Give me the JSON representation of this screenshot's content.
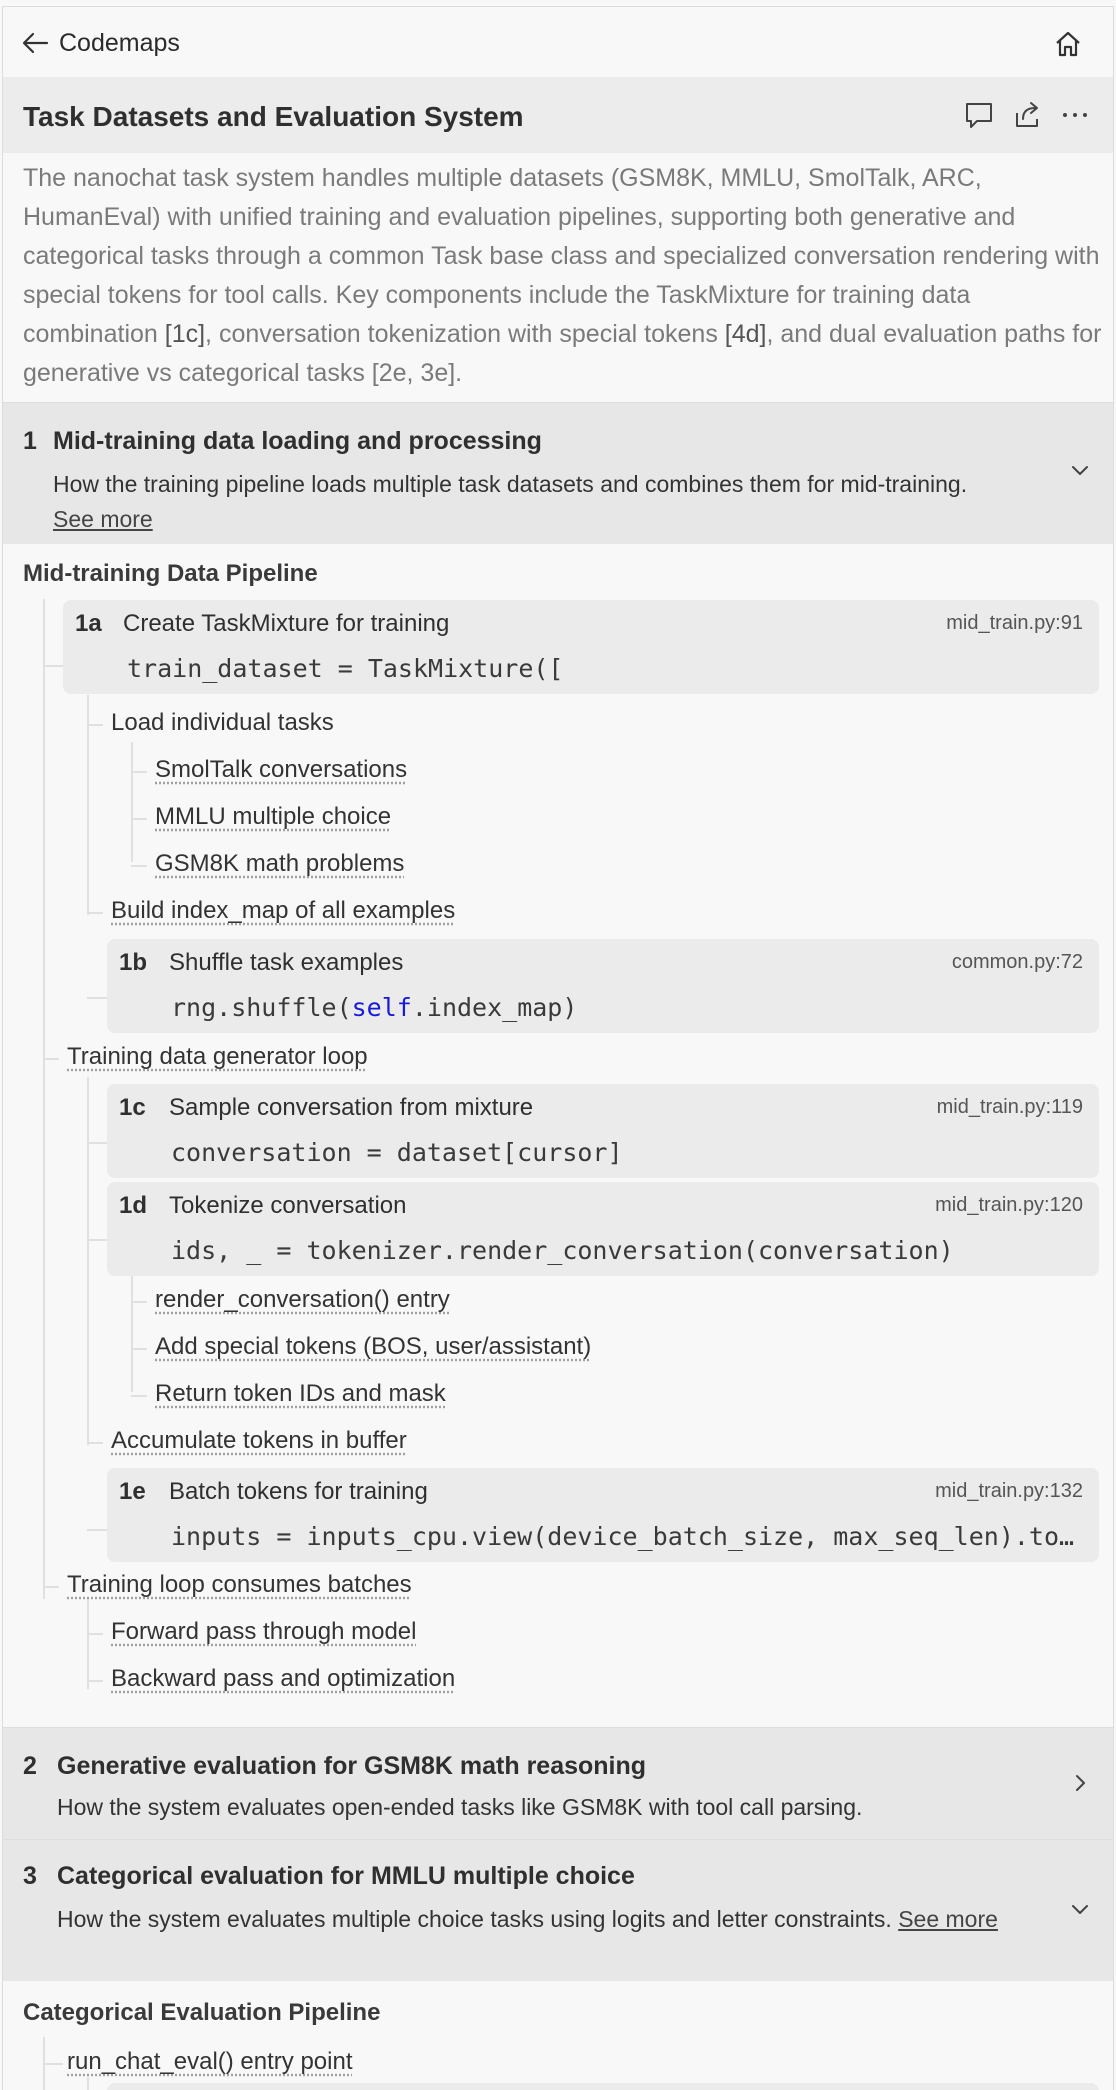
{
  "topbar": {
    "back_label": "Codemaps"
  },
  "header": {
    "title": "Task Datasets and Evaluation System"
  },
  "summary": {
    "text1": "The nanochat task system handles multiple datasets (GSM8K, MMLU, SmolTalk, ARC, HumanEval) with unified training and evaluation pipelines, supporting both generative and categorical tasks through a common Task base class and specialized conversation rendering with special tokens for tool calls. Key components include the TaskMixture for training data combination ",
    "ref1": "[1c]",
    "text2": ", conversation tokenization with special tokens ",
    "ref2": "[4d]",
    "text3": ", and dual evaluation paths for generative vs categorical tasks [2e, 3e]."
  },
  "sections": [
    {
      "num": "1",
      "title": "Mid-training data loading and processing",
      "desc": "How the training pipeline loads multiple task datasets and combines them for mid-training.",
      "see_more": "See more",
      "pipeline_title": "Mid-training Data Pipeline"
    },
    {
      "num": "2",
      "title": "Generative evaluation for GSM8K math reasoning",
      "desc": "How the system evaluates open-ended tasks like GSM8K with tool call parsing."
    },
    {
      "num": "3",
      "title": "Categorical evaluation for MMLU multiple choice",
      "desc": "How the system evaluates multiple choice tasks using logits and letter constraints.",
      "see_more": "See more",
      "pipeline_title": "Categorical Evaluation Pipeline"
    }
  ],
  "steps": {
    "s1a": {
      "id": "1a",
      "title": "Create TaskMixture for training",
      "file": "mid_train.py:91",
      "code": "train_dataset = TaskMixture(["
    },
    "s1b": {
      "id": "1b",
      "title": "Shuffle task examples",
      "file": "common.py:72",
      "code_pre": "rng.shuffle(",
      "code_kw": "self",
      "code_post": ".index_map)"
    },
    "s1c": {
      "id": "1c",
      "title": "Sample conversation from mixture",
      "file": "mid_train.py:119",
      "code": "conversation = dataset[cursor]"
    },
    "s1d": {
      "id": "1d",
      "title": "Tokenize conversation",
      "file": "mid_train.py:120",
      "code": "ids, _ = tokenizer.render_conversation(conversation)"
    },
    "s1e": {
      "id": "1e",
      "title": "Batch tokens for training",
      "file": "mid_train.py:132",
      "code": "inputs = inputs_cpu.view(device_batch_size, max_seq_len).to(device)"
    }
  },
  "tree": {
    "load_tasks": "Load individual tasks",
    "smoltalk": "SmolTalk conversations",
    "mmlu": "MMLU multiple choice",
    "gsm8k": "GSM8K math problems",
    "index_map": "Build index_map of all examples",
    "gen_loop": "Training data generator loop",
    "render_entry": "render_conversation() entry",
    "special_tokens": "Add special tokens (BOS, user/assistant)",
    "return_ids": "Return token IDs and mask",
    "accumulate": "Accumulate tokens in buffer",
    "consume": "Training loop consumes batches",
    "forward": "Forward pass through model",
    "backward": "Backward pass and optimization",
    "run_eval": "run_chat_eval() entry point"
  }
}
